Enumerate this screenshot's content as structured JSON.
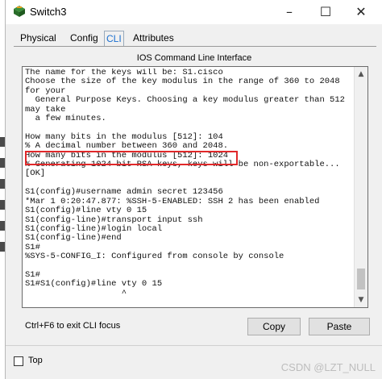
{
  "window": {
    "title": "Switch3",
    "controls": {
      "minimize": "–",
      "maximize": "☐",
      "close": "✕"
    }
  },
  "tabs": [
    {
      "label": "Physical",
      "active": false
    },
    {
      "label": "Config",
      "active": false
    },
    {
      "label": "CLI",
      "active": true
    },
    {
      "label": "Attributes",
      "active": false
    }
  ],
  "cli": {
    "panel_title": "IOS Command Line Interface",
    "lines": [
      "The name for the keys will be: S1.cisco",
      "Choose the size of the key modulus in the range of 360 to 2048",
      "for your",
      "  General Purpose Keys. Choosing a key modulus greater than 512",
      "may take",
      "  a few minutes.",
      "",
      "How many bits in the modulus [512]: 104",
      "% A decimal number between 360 and 2048.",
      "How many bits in the modulus [512]: 1024",
      "% Generating 1024 bit RSA keys, keys will be non-exportable...",
      "[OK]",
      "",
      "S1(config)#username admin secret 123456",
      "*Mar 1 0:20:47.877: %SSH-5-ENABLED: SSH 2 has been enabled",
      "S1(config)#line vty 0 15",
      "S1(config-line)#transport input ssh",
      "S1(config-line)#login local",
      "S1(config-line)#end",
      "S1#",
      "%SYS-5-CONFIG_I: Configured from console by console",
      "",
      "S1#",
      "S1#S1(config)#line vty 0 15",
      "                   ^"
    ],
    "highlight_color": "#e0282a"
  },
  "footer": {
    "hint": "Ctrl+F6 to exit CLI focus",
    "copy_label": "Copy",
    "paste_label": "Paste"
  },
  "bottom": {
    "top_label": "Top",
    "watermark": "CSDN @LZT_NULL"
  }
}
